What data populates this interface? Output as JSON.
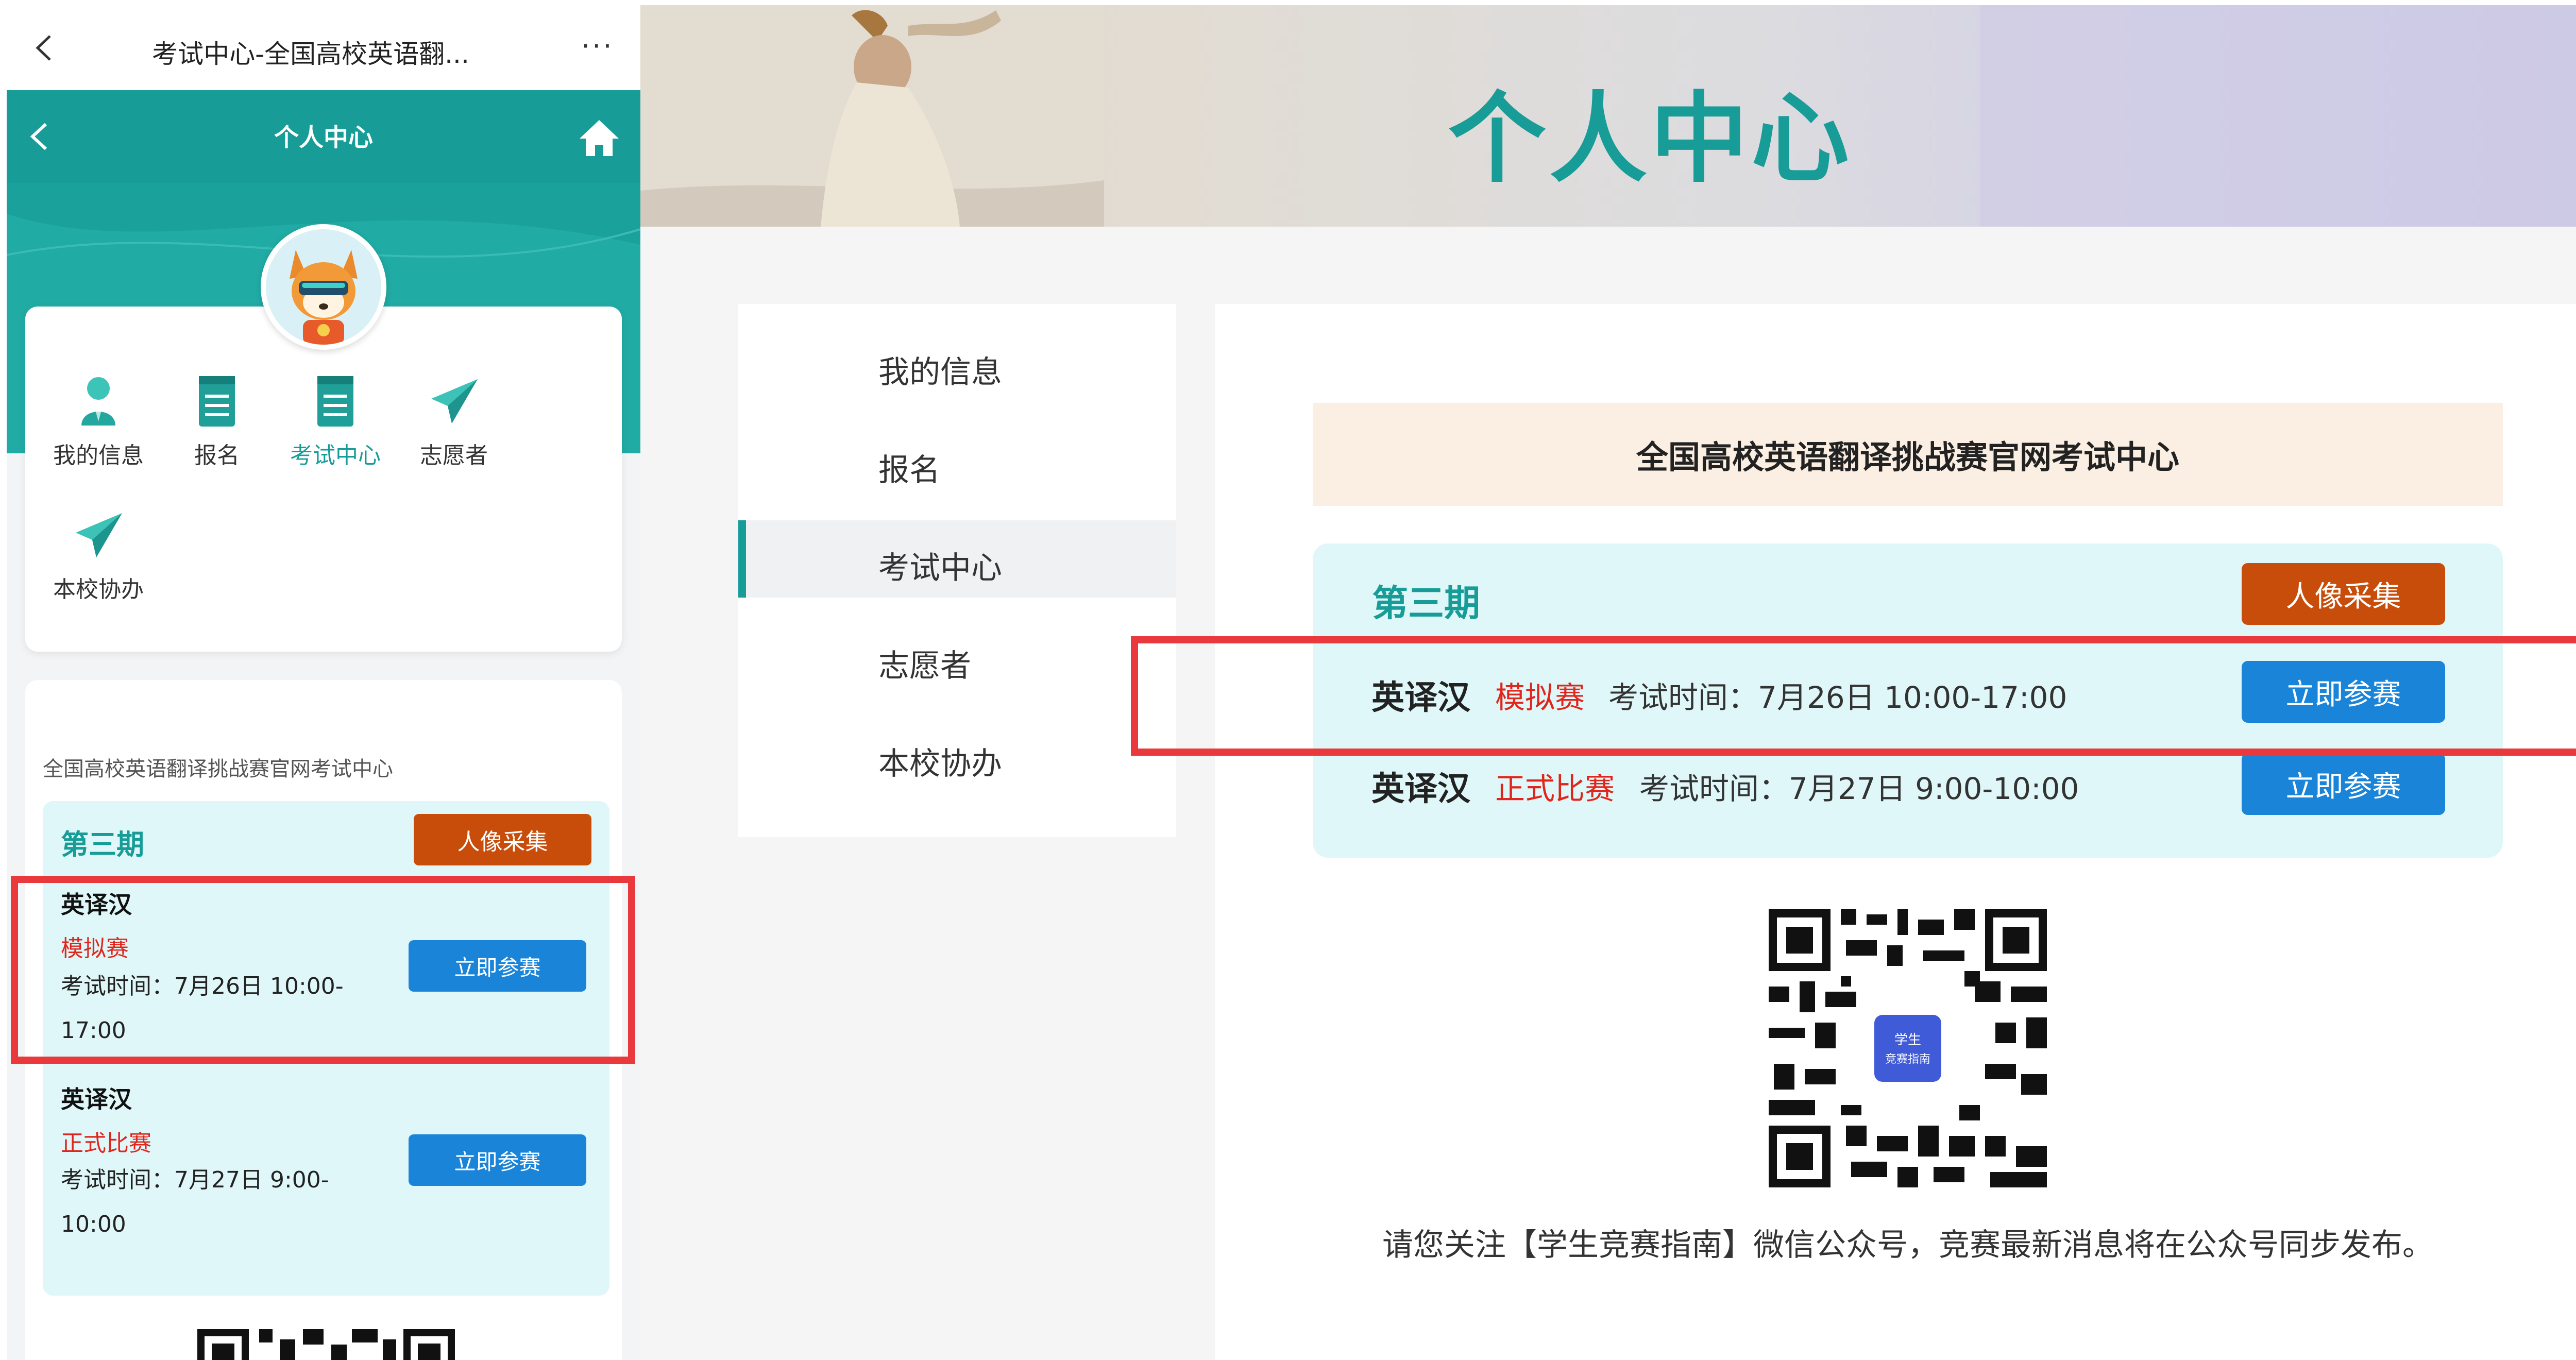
{
  "mobile": {
    "topbar": {
      "title": "考试中心-全国高校英语翻...",
      "more": "···"
    },
    "header": {
      "title": "个人中心"
    },
    "menu": [
      {
        "label": "我的信息",
        "icon": "user-icon"
      },
      {
        "label": "报名",
        "icon": "notepad-icon"
      },
      {
        "label": "考试中心",
        "icon": "notepad-icon",
        "active": true
      },
      {
        "label": "志愿者",
        "icon": "paper-plane-icon"
      },
      {
        "label": "本校协办",
        "icon": "paper-plane-icon"
      }
    ],
    "exam_center": {
      "title": "全国高校英语翻译挑战赛官网考试中心",
      "period": "第三期",
      "photo_button": "人像采集",
      "exams": [
        {
          "name": "英译汉",
          "type": "模拟赛",
          "time": "考试时间：7月26日 10:00-17:00",
          "button": "立即参赛"
        },
        {
          "name": "英译汉",
          "type": "正式比赛",
          "time": "考试时间：7月27日 9:00-10:00",
          "button": "立即参赛"
        }
      ]
    }
  },
  "desktop": {
    "banner_title": "个人中心",
    "nav": [
      {
        "label": "我的信息"
      },
      {
        "label": "报名"
      },
      {
        "label": "考试中心",
        "active": true
      },
      {
        "label": "志愿者"
      },
      {
        "label": "本校协办"
      }
    ],
    "exam_center": {
      "title": "全国高校英语翻译挑战赛官网考试中心",
      "period": "第三期",
      "photo_button": "人像采集",
      "exams": [
        {
          "name": "英译汉",
          "type": "模拟赛",
          "time": "考试时间：7月26日 10:00-17:00",
          "button": "立即参赛"
        },
        {
          "name": "英译汉",
          "type": "正式比赛",
          "time": "考试时间：7月27日 9:00-10:00",
          "button": "立即参赛"
        }
      ]
    },
    "qr_logo_text": "学生竞赛指南",
    "follow_text": "请您关注【学生竞赛指南】微信公众号，竞赛最新消息将在公众号同步发布。"
  },
  "colors": {
    "brand_teal": "#179c98",
    "photo_orange": "#c84d0a",
    "join_blue": "#1a84d9",
    "highlight_red": "#e9393c",
    "exam_type_red": "#e0261c"
  }
}
